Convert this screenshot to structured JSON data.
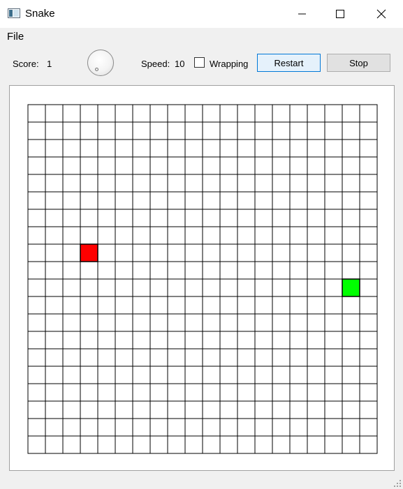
{
  "window": {
    "title": "Snake",
    "app_icon": "window-app-icon",
    "controls": [
      "minimize-icon",
      "maximize-icon",
      "close-icon"
    ]
  },
  "menu": {
    "items": [
      "File"
    ]
  },
  "toolbar": {
    "score_label": "Score:",
    "score_value": "1",
    "speed_label": "Speed:",
    "speed_value": "10",
    "wrapping_label": "Wrapping",
    "wrapping_checked": false,
    "restart_label": "Restart",
    "stop_label": "Stop"
  },
  "board": {
    "columns": 20,
    "rows": 20,
    "grid_color": "#000000",
    "background": "#ffffff",
    "food": {
      "col": 3,
      "row": 8,
      "color": "#ff0000"
    },
    "snake": [
      {
        "col": 18,
        "row": 10
      }
    ],
    "snake_color": "#00ff00"
  }
}
